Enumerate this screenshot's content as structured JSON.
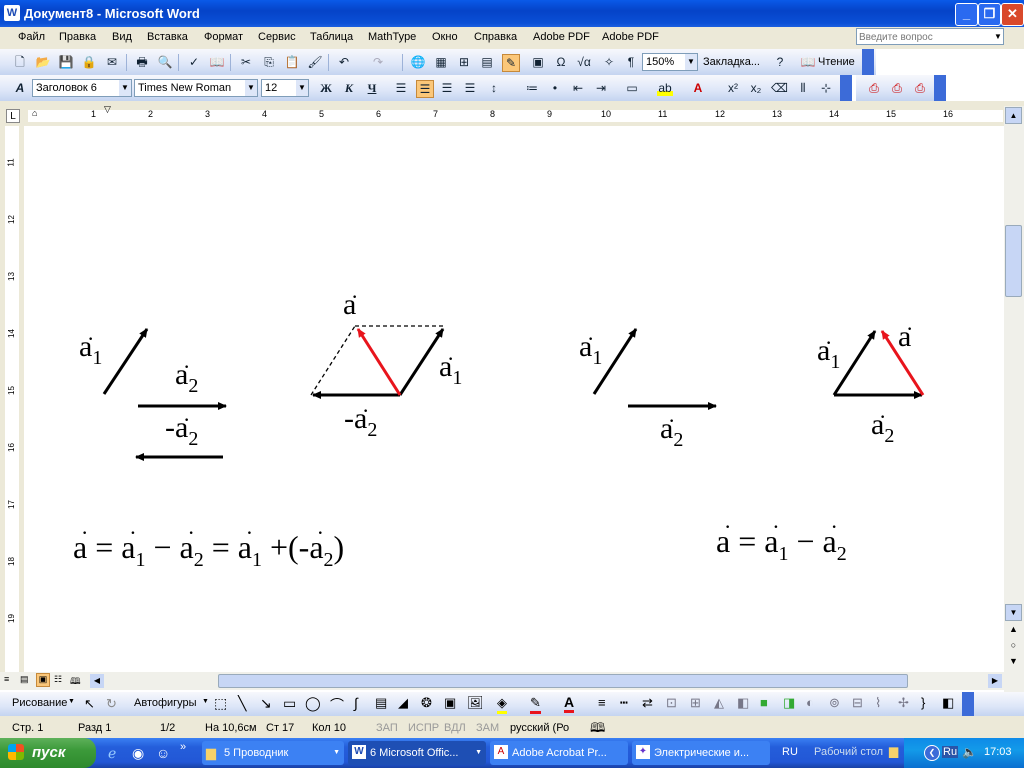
{
  "window": {
    "title": "Документ8 - Microsoft Word",
    "icon": "W",
    "min": "_",
    "max": "❐",
    "close": "✕"
  },
  "menu": [
    "Файл",
    "Правка",
    "Вид",
    "Вставка",
    "Формат",
    "Сервис",
    "Таблица",
    "MathType",
    "Окно",
    "Справка",
    "Adobe PDF",
    "Adobe PDF"
  ],
  "help": {
    "placeholder": "Введите вопрос"
  },
  "toolbar1": {
    "zoom": "150%",
    "bookmark": "Закладка...",
    "reading": "Чтение"
  },
  "toolbar2": {
    "style": "Заголовок 6",
    "font": "Times New Roman",
    "size": "12"
  },
  "ruler_h": [
    "1",
    "2",
    "3",
    "4",
    "5",
    "6",
    "7",
    "8",
    "9",
    "10",
    "11",
    "12",
    "13",
    "14",
    "15",
    "16"
  ],
  "ruler_v": [
    "11",
    "12",
    "13",
    "14",
    "15",
    "16",
    "17",
    "18",
    "19"
  ],
  "fig_left": {
    "a1": "a",
    "a1_sub": "1",
    "a2": "a",
    "a2_sub": "2",
    "neg_a2": "-a",
    "neg_a2_sub": "2",
    "a_sum": "a",
    "a1_par": "a",
    "a1_par_sub": "1",
    "neg_a2_par": "-a",
    "neg_a2_par_sub": "2"
  },
  "fig_right": {
    "a1": "a",
    "a1_sub": "1",
    "a2": "a",
    "a2_sub": "2",
    "tri_a1": "a",
    "tri_a1_sub": "1",
    "tri_a": "a",
    "tri_a2": "a",
    "tri_a2_sub": "2"
  },
  "formula_left": {
    "a": "a",
    "eq1": "=",
    "a1": "a",
    "sub1": "1",
    "minus": "−",
    "a2": "a",
    "sub2": "2",
    "eq2": "=",
    "a1b": "a",
    "sub1b": "1",
    "plus": "+",
    "lparen": "(",
    "neg": "-a",
    "sub2b": "2",
    "rparen": ")"
  },
  "formula_right": {
    "a": "a",
    "eq": "=",
    "a1": "a",
    "sub1": "1",
    "minus": "−",
    "a2": "a",
    "sub2": "2"
  },
  "drawbar": {
    "draw": "Рисование",
    "autoshapes": "Автофигуры"
  },
  "status": {
    "page": "Стр. 1",
    "section": "Разд 1",
    "pages": "1/2",
    "at": "На 10,6см",
    "line": "Ст 17",
    "col": "Кол 10",
    "rec": "ЗАП",
    "trk": "ИСПР",
    "ext": "ВДЛ",
    "ovr": "ЗАМ",
    "lang": "русский (Ро"
  },
  "taskbar": {
    "start": "пуск",
    "tasks": [
      "5 Проводник",
      "6 Microsoft Offic...",
      "Adobe Acrobat Pr...",
      "Электрические и..."
    ],
    "lang": "RU",
    "desktop": "Рабочий стол",
    "time": "17:03"
  },
  "colors": {
    "red_vector": "#e8141c",
    "titlebar": "#0543c8",
    "taskbar": "#245edb"
  }
}
